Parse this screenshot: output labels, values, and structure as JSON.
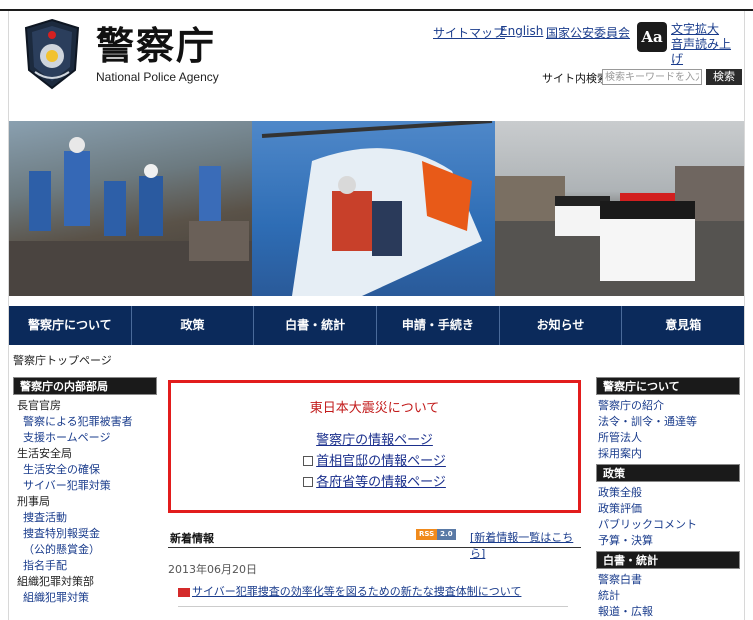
{
  "header": {
    "logo_jp": "警察庁",
    "logo_en": "National Police Agency",
    "links": {
      "sitemap": "サイトマップ",
      "english": "English",
      "psc": "国家公安委員会"
    },
    "accessibility_label": "文字拡大 音声読み上げ",
    "accessibility_icon": "Aa",
    "search": {
      "label": "サイト内検索",
      "placeholder": "検索キーワードを入力",
      "button": "検索"
    }
  },
  "nav": {
    "items": [
      "警察庁について",
      "政策",
      "白書・統計",
      "申請・手続き",
      "お知らせ",
      "意見箱"
    ]
  },
  "breadcrumb": "警察庁トップページ",
  "left_sidebar": {
    "heading": "警察庁の内部部局",
    "groups": [
      {
        "category": "長官官房",
        "links": [
          "警察による犯罪被害者",
          "支援ホームページ"
        ]
      },
      {
        "category": "生活安全局",
        "links": [
          "生活安全の確保",
          "サイバー犯罪対策"
        ]
      },
      {
        "category": "刑事局",
        "links": [
          "捜査活動",
          "捜査特別報奨金",
          "（公的懸賞金）",
          "指名手配"
        ]
      },
      {
        "category": "組織犯罪対策部",
        "links": [
          "組織犯罪対策"
        ]
      }
    ]
  },
  "right_sidebar": {
    "sections": [
      {
        "heading": "警察庁について",
        "links": [
          "警察庁の紹介",
          "法令・訓令・通達等",
          "所管法人",
          "採用案内"
        ]
      },
      {
        "heading": "政策",
        "links": [
          "政策全般",
          "政策評価",
          "パブリックコメント",
          "予算・決算"
        ]
      },
      {
        "heading": "白書・統計",
        "links": [
          "警察白書",
          "統計",
          "報道・広報"
        ]
      }
    ]
  },
  "notice": {
    "title": "東日本大震災について",
    "links": [
      "警察庁の情報ページ",
      "首相官邸の情報ページ",
      "各府省等の情報ページ"
    ]
  },
  "news": {
    "title": "新着情報",
    "rss": [
      "RSS",
      "2.0"
    ],
    "all_link": "[新着情報一覧はこちら]",
    "date": "2013年06月20日",
    "item": "サイバー犯罪捜査の効率化等を図るための新たな捜査体制について"
  },
  "colors": {
    "nav_bg": "#0b2a5b",
    "notice_border": "#e21c1c",
    "notice_title": "#c21b1b",
    "link": "#1a3c8c"
  }
}
